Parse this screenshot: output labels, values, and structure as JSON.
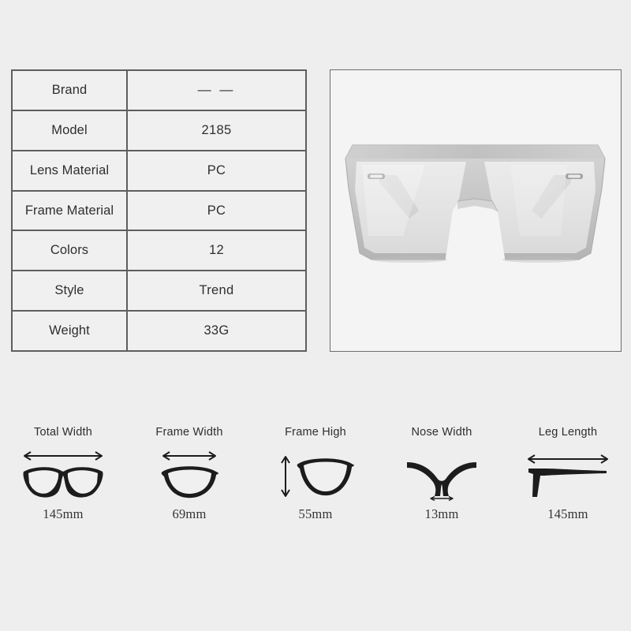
{
  "background_color": "#eeeeee",
  "spec_table": {
    "border_color": "#5e5e5e",
    "rows": [
      {
        "label": "Brand",
        "value": "— —"
      },
      {
        "label": "Model",
        "value": "2185"
      },
      {
        "label": "Lens Material",
        "value": "PC"
      },
      {
        "label": "Frame Material",
        "value": "PC"
      },
      {
        "label": "Colors",
        "value": "12"
      },
      {
        "label": "Style",
        "value": "Trend"
      },
      {
        "label": "Weight",
        "value": "33G"
      }
    ]
  },
  "product_image": {
    "alt": "oversized flat-top shield sunglasses, silver mirrored lens",
    "icon": "sunglasses-product-photo",
    "frame_color": "#c9c9c9",
    "lens_color": "#e3e3e3",
    "background_color": "#f4f4f4"
  },
  "measurements": [
    {
      "label": "Total Width",
      "value": "145mm",
      "icon": "full-glasses-icon",
      "arrow": "horizontal-double-arrow"
    },
    {
      "label": "Frame Width",
      "value": "69mm",
      "icon": "single-lens-icon",
      "arrow": "horizontal-double-arrow"
    },
    {
      "label": "Frame High",
      "value": "55mm",
      "icon": "single-lens-icon",
      "arrow": "vertical-double-arrow"
    },
    {
      "label": "Nose Width",
      "value": "13mm",
      "icon": "nose-bridge-icon",
      "arrow": "horizontal-double-arrow"
    },
    {
      "label": "Leg Length",
      "value": "145mm",
      "icon": "temple-arm-icon",
      "arrow": "horizontal-double-arrow"
    }
  ]
}
